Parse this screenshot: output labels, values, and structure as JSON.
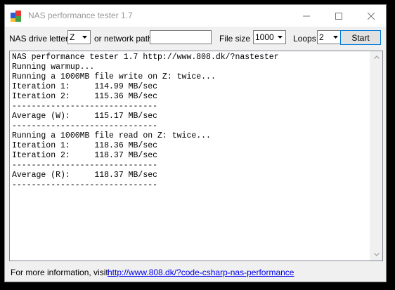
{
  "window": {
    "title": "NAS performance tester 1.7"
  },
  "toolbar": {
    "drive_label": "NAS drive letter",
    "drive_value": "Z",
    "network_path_label": "or network path",
    "network_path_value": "",
    "file_size_label": "File size",
    "file_size_value": "1000",
    "loops_label": "Loops",
    "loops_value": "2",
    "start_label": "Start"
  },
  "output": {
    "lines": [
      "NAS performance tester 1.7 http://www.808.dk/?nastester",
      "Running warmup...",
      "Running a 1000MB file write on Z: twice...",
      "Iteration 1:     114.99 MB/sec",
      "Iteration 2:     115.36 MB/sec",
      "------------------------------",
      "Average (W):     115.17 MB/sec",
      "------------------------------",
      "Running a 1000MB file read on Z: twice...",
      "Iteration 1:     118.36 MB/sec",
      "Iteration 2:     118.37 MB/sec",
      "------------------------------",
      "Average (R):     118.37 MB/sec",
      "------------------------------"
    ]
  },
  "footer": {
    "info_label": "For more information, visit",
    "link_text": "http://www.808.dk/?code-csharp-nas-performance"
  },
  "icons": {
    "app": "nas-tester-app-icon",
    "minimize": "minimize-icon",
    "maximize": "maximize-icon",
    "close": "close-icon",
    "dropdown": "chevron-down-icon"
  }
}
